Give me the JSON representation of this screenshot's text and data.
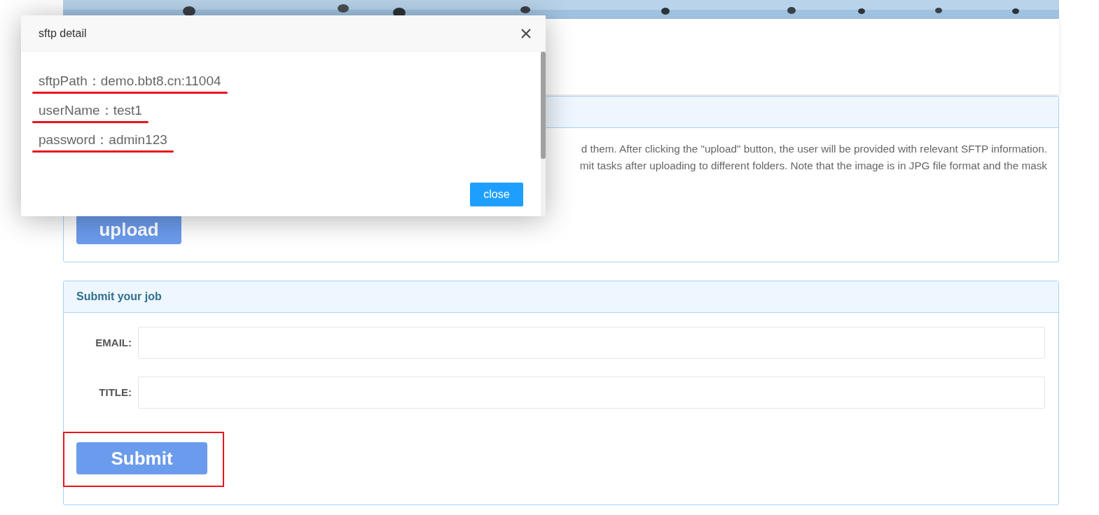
{
  "upload_panel": {
    "description_lines": [
      "d them. After clicking the \"upload\" button, the user will be provided with relevant SFTP information.",
      "mit tasks after uploading to different folders. Note that the image is in JPG file format and the mask"
    ],
    "button": "upload"
  },
  "submit_panel": {
    "title": "Submit your job",
    "fields": [
      {
        "label": "EMAIL:"
      },
      {
        "label": "TITLE:"
      }
    ],
    "submit": {
      "label": "Submit",
      "highlighted": true
    }
  },
  "modal": {
    "title": "sftp detail",
    "lines": [
      {
        "text": "sftpPath：demo.bbt8.cn:11004",
        "underlined": true
      },
      {
        "text": "userName：test1",
        "underlined": true
      },
      {
        "text": "password：admin123",
        "underlined": true
      }
    ],
    "button": "close"
  }
}
